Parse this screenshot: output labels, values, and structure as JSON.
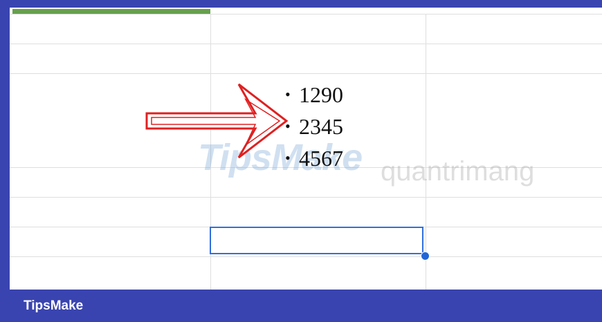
{
  "sheet": {
    "bullets": [
      {
        "marker": "•",
        "value": "1290"
      },
      {
        "marker": "•",
        "value": "2345"
      },
      {
        "marker": "•",
        "value": "4567"
      }
    ]
  },
  "watermark": {
    "brand": "TipsMake",
    "secondary": "quantrimang"
  },
  "footer": {
    "brand": "TipsMake"
  },
  "colors": {
    "frame": "#3a44b0",
    "header_accent": "#66a04e",
    "selection": "#2f6fde",
    "arrow": "#e02020"
  }
}
